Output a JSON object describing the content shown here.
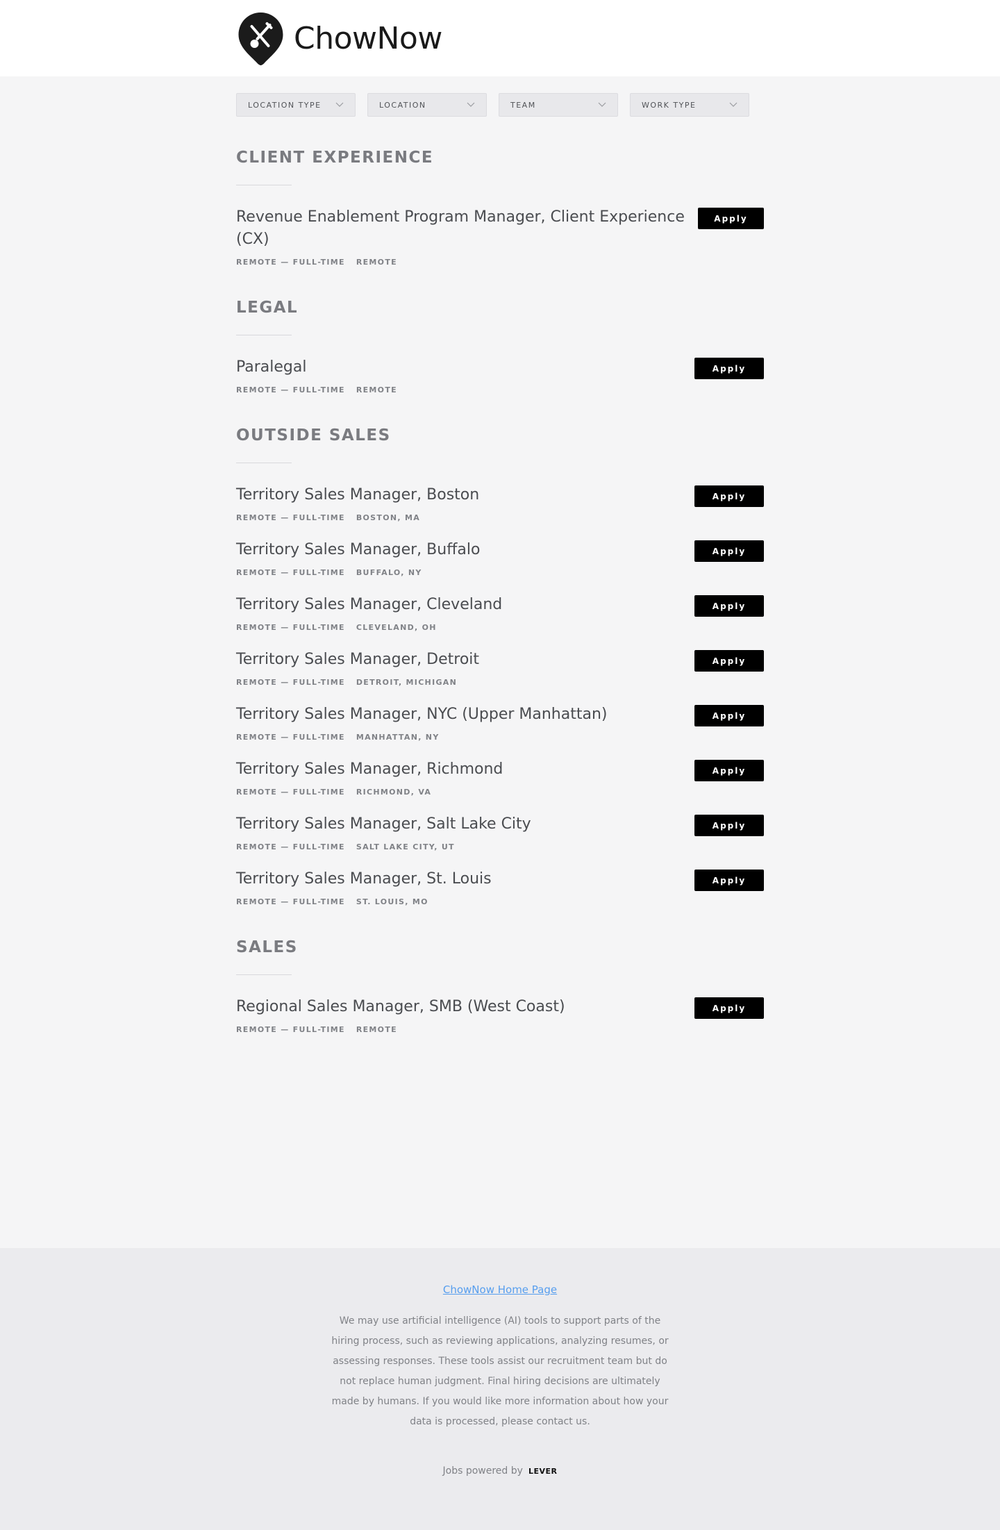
{
  "brand": {
    "name": "ChowNow",
    "logo_icon": "fork-knife-pin-icon"
  },
  "filters": [
    {
      "label": "Location type"
    },
    {
      "label": "Location"
    },
    {
      "label": "Team"
    },
    {
      "label": "Work type"
    }
  ],
  "groups": [
    {
      "title": "Client Experience",
      "postings": [
        {
          "title": "Revenue Enablement Program Manager, Client Experience (CX)",
          "commitment": "Remote — Full-Time",
          "location": "Remote",
          "apply": "Apply"
        }
      ]
    },
    {
      "title": "Legal",
      "postings": [
        {
          "title": "Paralegal",
          "commitment": "Remote — Full-Time",
          "location": "Remote",
          "apply": "Apply"
        }
      ]
    },
    {
      "title": "Outside Sales",
      "postings": [
        {
          "title": "Territory Sales Manager, Boston",
          "commitment": "Remote — Full-Time",
          "location": "Boston, MA",
          "apply": "Apply"
        },
        {
          "title": "Territory Sales Manager, Buffalo",
          "commitment": "Remote — Full-Time",
          "location": "Buffalo, NY",
          "apply": "Apply"
        },
        {
          "title": "Territory Sales Manager, Cleveland",
          "commitment": "Remote — Full-Time",
          "location": "Cleveland, OH",
          "apply": "Apply"
        },
        {
          "title": "Territory Sales Manager, Detroit",
          "commitment": "Remote — Full-Time",
          "location": "Detroit, Michigan",
          "apply": "Apply"
        },
        {
          "title": "Territory Sales Manager, NYC (Upper Manhattan)",
          "commitment": "Remote — Full-Time",
          "location": "Manhattan, NY",
          "apply": "Apply"
        },
        {
          "title": "Territory Sales Manager, Richmond",
          "commitment": "Remote — Full-Time",
          "location": "Richmond, VA",
          "apply": "Apply"
        },
        {
          "title": "Territory Sales Manager, Salt Lake City",
          "commitment": "Remote — Full-Time",
          "location": "Salt Lake City, UT",
          "apply": "Apply"
        },
        {
          "title": "Territory Sales Manager, St. Louis",
          "commitment": "Remote — Full-Time",
          "location": "St. Louis, MO",
          "apply": "Apply"
        }
      ]
    },
    {
      "title": "Sales",
      "postings": [
        {
          "title": "Regional Sales Manager, SMB (West Coast)",
          "commitment": "Remote — Full-Time",
          "location": "Remote",
          "apply": "Apply"
        }
      ]
    }
  ],
  "footer": {
    "home_link": "ChowNow Home Page",
    "disclaimer": "We may use artificial intelligence (AI) tools to support parts of the hiring process, such as reviewing applications, analyzing resumes, or assessing responses. These tools assist our recruitment team but do not replace human judgment. Final hiring decisions are ultimately made by humans. If you would like more information about how your data is processed, please contact us.",
    "powered_by": "Jobs powered by",
    "lever": "LEVER"
  },
  "colors": {
    "accent_link": "#579eee",
    "button_bg": "#000000"
  }
}
